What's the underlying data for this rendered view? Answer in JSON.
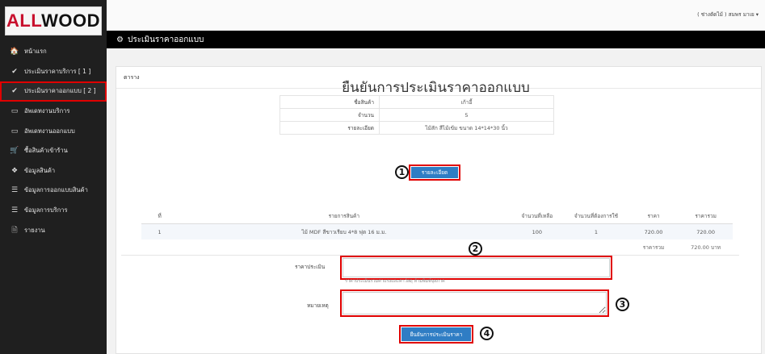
{
  "logo": {
    "text_accent": "ALL",
    "text_rest": "WOOD"
  },
  "user_menu": {
    "label": "( ช่างตัดไม้ ) สมพร มาเย ▾"
  },
  "sidebar": {
    "items": [
      {
        "icon": "home-icon",
        "glyph": "🏠",
        "label": "หน้าแรก"
      },
      {
        "icon": "check-circle-icon",
        "glyph": "✔",
        "label": "ประเมินราคาบริการ [ 1 ]"
      },
      {
        "icon": "check-circle-icon",
        "glyph": "✔",
        "label": "ประเมินราคาออกแบบ [ 2 ]"
      },
      {
        "icon": "window-icon",
        "glyph": "▭",
        "label": "อัพเดทงานบริการ"
      },
      {
        "icon": "window-icon",
        "glyph": "▭",
        "label": "อัพเดทงานออกแบบ"
      },
      {
        "icon": "cart-icon",
        "glyph": "🛒",
        "label": "ซื้อสินค้าเข้าร้าน"
      },
      {
        "icon": "cubes-icon",
        "glyph": "❖",
        "label": "ข้อมูลสินค้า"
      },
      {
        "icon": "list-icon",
        "glyph": "☰",
        "label": "ข้อมูลการออกแบบสินค้า"
      },
      {
        "icon": "list-icon",
        "glyph": "☰",
        "label": "ข้อมูลการบริการ"
      },
      {
        "icon": "file-icon",
        "glyph": "🗎",
        "label": "รายงาน"
      }
    ]
  },
  "titlebar": {
    "icon": "gear-icon",
    "glyph": "⚙",
    "title": "ประเมินราคาออกแบบ"
  },
  "panel": {
    "header": "ตาราง"
  },
  "heading": "ยืนยันการประเมินราคาออกแบบ",
  "info": {
    "name_label": "ชื่อสินค้า",
    "name_value": "เก้าอี้",
    "qty_label": "จำนวน",
    "qty_value": "5",
    "detail_label": "รายละเอียด",
    "detail_value": "ไม้สัก สีไม้เข้ม ขนาด 14*14*30 นิ้ว"
  },
  "detail_button": "รายละเอียด",
  "products": {
    "headers": [
      "ที่",
      "รายการสินค้า",
      "จำนวนที่เหลือ",
      "จำนวนที่ต้องการใช้",
      "ราคา",
      "ราคารวม"
    ],
    "rows": [
      {
        "no": "1",
        "name": "ไม้ MDF สีขาวเรียบ 4*8 ฟุต 16 ม.ม.",
        "remaining": "100",
        "required": "1",
        "price": "720.00",
        "total": "720.00"
      }
    ],
    "sum_label": "ราคารวม",
    "sum_value": "720.00 บาท"
  },
  "form": {
    "price_label": "ราคาประเมิน",
    "price_value": "",
    "price_hint": "ราคาประเมินรวมค่าแรงและค่าวัสดุ ห้ามพิมพ์จุลภาค",
    "note_label": "หมายเหตุ",
    "note_value": "",
    "submit_label": "ยืนยันการประเมินราคา"
  },
  "steps": [
    "1",
    "2",
    "3",
    "4"
  ],
  "colors": {
    "sidebar": "#1f1f1f",
    "titlebar": "#000000",
    "primary": "#2f7dc4",
    "highlight": "#e00000"
  }
}
